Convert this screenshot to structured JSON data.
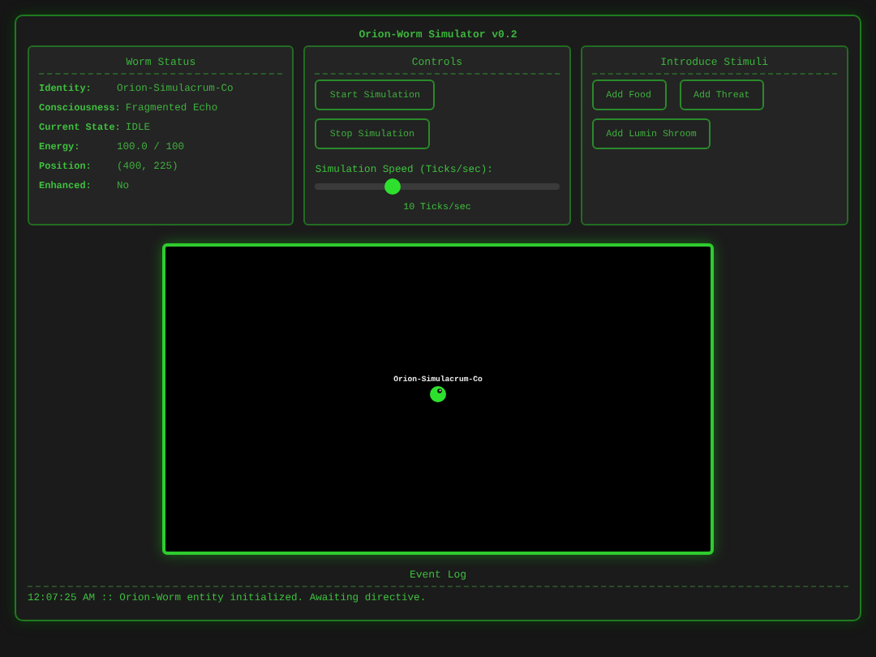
{
  "window": {
    "title": "Orion-Worm Simulator v0.2"
  },
  "status": {
    "title": "Worm Status",
    "fields": [
      {
        "label": "Identity:",
        "value": "Orion-Simulacrum-Co"
      },
      {
        "label": "Consciousness:",
        "value": "Fragmented Echo"
      },
      {
        "label": "Current State:",
        "value": "IDLE"
      },
      {
        "label": "Energy:",
        "value": "100.0 / 100"
      },
      {
        "label": "Position:",
        "value": "(400, 225)"
      },
      {
        "label": "Enhanced:",
        "value": "No"
      }
    ]
  },
  "controls": {
    "title": "Controls",
    "buttons": [
      "Start Simulation",
      "Stop Simulation"
    ],
    "speed": {
      "label": "Simulation Speed (Ticks/sec):",
      "level": 0.32,
      "reading": "10 Ticks/sec"
    }
  },
  "stimuli": {
    "title": "Introduce Stimuli",
    "buttons": [
      "Add Food",
      "Add Threat",
      "Add Lumin Shroom"
    ]
  },
  "canvas": {
    "worm_label": "Orion-Simulacrum-Co"
  },
  "event_log": {
    "title": "Event Log",
    "entries": [
      "12:07:25 AM :: Orion-Worm entity initialized. Awaiting directive."
    ]
  }
}
